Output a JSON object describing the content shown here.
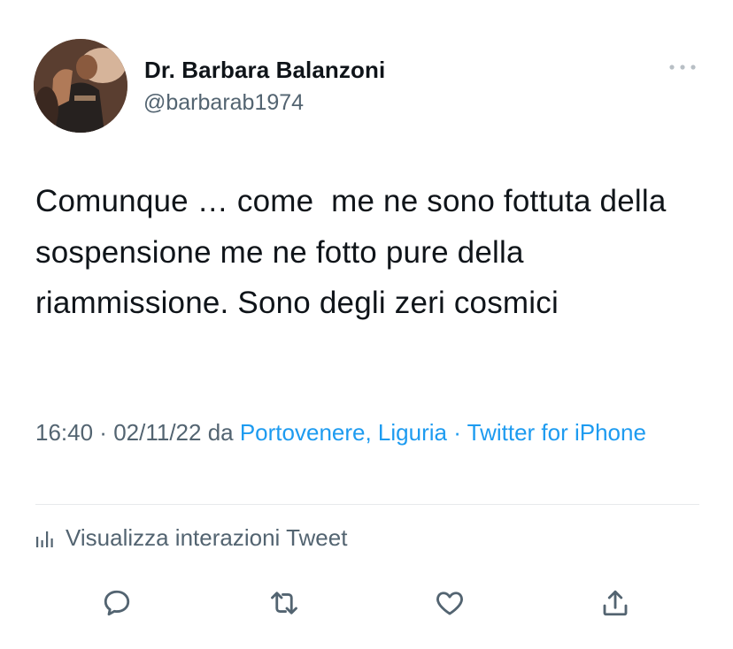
{
  "author": {
    "display_name": "Dr. Barbara Balanzoni",
    "handle": "@barbarab1974"
  },
  "tweet": {
    "text": "Comunque … come  me ne sono fottuta della sospensione me ne fotto pure della riammissione. Sono degli zeri cosmici"
  },
  "meta": {
    "time": "16:40",
    "sep1": " · ",
    "date": "02/11/22",
    "da": " da ",
    "location": "Portovenere, Liguria",
    "sep2": " · ",
    "source": "Twitter for iPhone"
  },
  "analytics": {
    "label": "Visualizza interazioni Tweet"
  },
  "icons": {
    "more": "more-horizontal-icon",
    "analytics": "bar-chart-icon",
    "reply": "reply-bubble-icon",
    "retweet": "retweet-icon",
    "like": "heart-icon",
    "share": "share-upload-icon"
  },
  "colors": {
    "text_primary": "#0f1419",
    "text_secondary": "#536471",
    "link": "#1d9bf0",
    "divider": "#e7e9ec"
  }
}
